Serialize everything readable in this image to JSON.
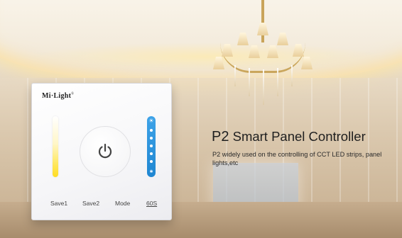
{
  "panel": {
    "brand": "Mi·Light",
    "brand_mark": "®",
    "buttons": {
      "save1": "Save1",
      "save2": "Save2",
      "mode": "Mode",
      "timer": "60S"
    },
    "icons": {
      "power": "power-icon",
      "brightness": "sun-icon",
      "dim": "star-icon"
    }
  },
  "headline": {
    "product": "P2",
    "title": " Smart Panel Controller",
    "description": "P2 widely used on the controlling of CCT LED strips, panel lights,etc"
  },
  "colors": {
    "slider_warm": "#ffdd23",
    "slider_blue": "#2b95dd"
  }
}
